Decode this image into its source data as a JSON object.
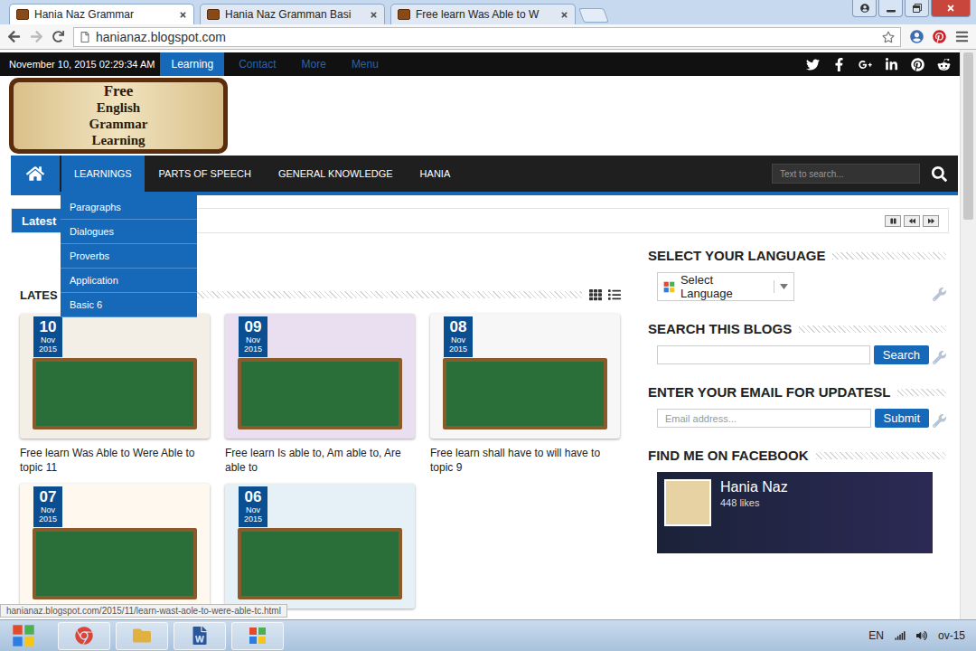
{
  "browser": {
    "tabs": [
      {
        "label": "Hania Naz Grammar",
        "selected": true
      },
      {
        "label": "Hania Naz Gramman Basi",
        "selected": false
      },
      {
        "label": "Free learn Was Able to W",
        "selected": false
      }
    ],
    "url": "hanianaz.blogspot.com",
    "status_url": "hanianaz.blogspot.com/2015/11/learn-wast-aole-to-were-able-tc.html"
  },
  "topbar": {
    "datetime": "November 10, 2015 02:29:34 AM",
    "links": [
      {
        "label": "Learning",
        "selected": true
      },
      {
        "label": "Contact",
        "selected": false
      },
      {
        "label": "More",
        "selected": false
      },
      {
        "label": "Menu",
        "selected": false
      }
    ]
  },
  "logo": {
    "lines": [
      "Free",
      "English",
      "Grammar",
      "Learning"
    ]
  },
  "nav": {
    "items": [
      {
        "label": "LEARNINGS",
        "selected": true
      },
      {
        "label": "PARTS OF SPEECH",
        "selected": false
      },
      {
        "label": "GENERAL KNOWLEDGE",
        "selected": false
      },
      {
        "label": "HANIA",
        "selected": false
      }
    ],
    "search_placeholder": "Text to search...",
    "dropdown": [
      "Paragraphs",
      "Dialogues",
      "Proverbs",
      "Application",
      "Basic 6"
    ]
  },
  "ticker": {
    "label": "Latest"
  },
  "posts": {
    "heading": "LATES",
    "items": [
      {
        "day": "10",
        "month": "Nov",
        "year": "2015",
        "caption": "Free learn Was Able to Were Able to topic 11"
      },
      {
        "day": "09",
        "month": "Nov",
        "year": "2015",
        "caption": "Free learn Is able to, Am able to, Are able to"
      },
      {
        "day": "08",
        "month": "Nov",
        "year": "2015",
        "caption": "Free learn shall have to will have to topic 9"
      },
      {
        "day": "07",
        "month": "Nov",
        "year": "2015"
      },
      {
        "day": "06",
        "month": "Nov",
        "year": "2015"
      }
    ]
  },
  "sidebar": {
    "language": {
      "title": "SELECT YOUR LANGUAGE",
      "select": "Select Language"
    },
    "search": {
      "title": "SEARCH THIS BLOGS",
      "button": "Search"
    },
    "email": {
      "title": "ENTER YOUR EMAIL FOR UPDATESL",
      "placeholder": "Email address...",
      "button": "Submit"
    },
    "facebook": {
      "title": "FIND ME ON FACEBOOK",
      "name": "Hania Naz",
      "likes": "448 likes"
    }
  },
  "taskbar": {
    "language": "EN",
    "clock": "ov-15"
  }
}
